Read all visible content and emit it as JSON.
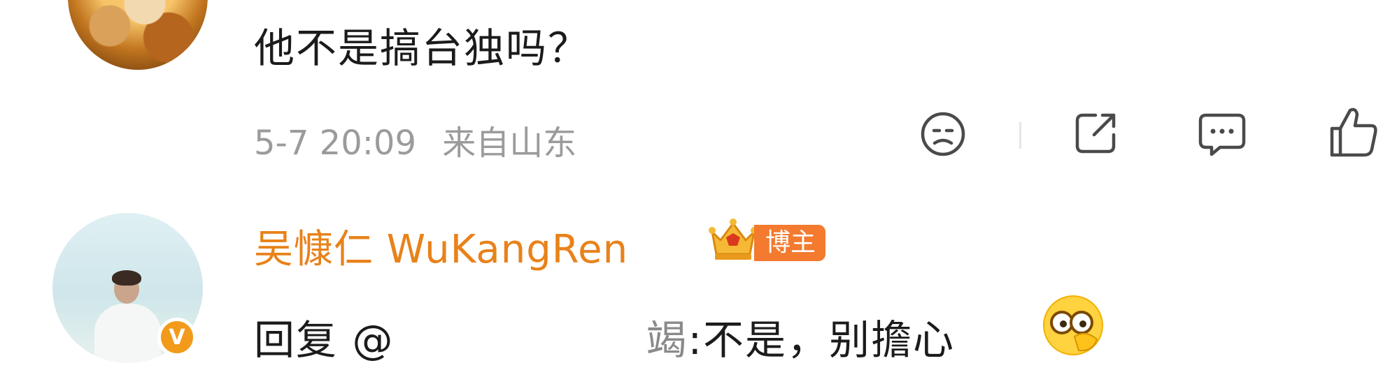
{
  "comment1": {
    "text": "他不是搞台独吗？",
    "timestamp": "5-7 20:09",
    "location": "来自山东"
  },
  "actions": {
    "icons": [
      "dislike-icon",
      "share-icon",
      "comment-icon",
      "like-icon"
    ]
  },
  "reply": {
    "username": "吴慷仁 WuKangRen",
    "badge": "博主",
    "prefix": "回复",
    "mention": "@",
    "mention_tail": "竭",
    "text": ":不是，别擔心",
    "emoji": "peeking-emoji"
  },
  "colors": {
    "username": "#e8821a",
    "badge": "#f37a2e",
    "meta": "#9b9b9b",
    "verified": "#f29a1a"
  }
}
